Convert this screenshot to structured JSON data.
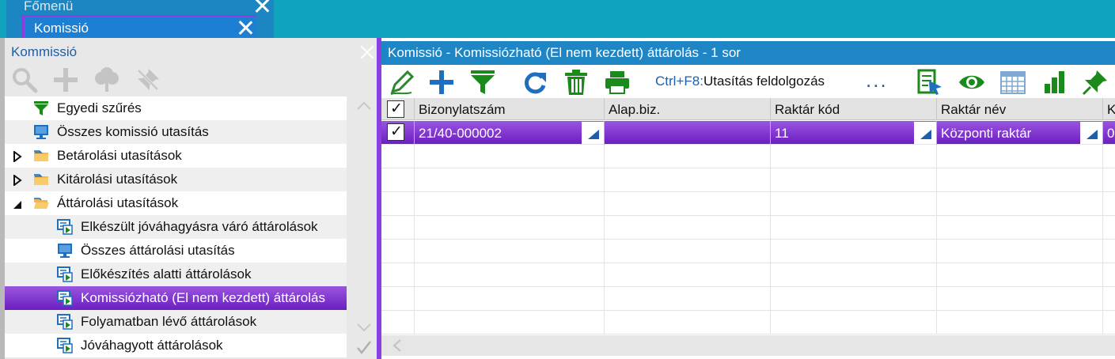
{
  "tabs": {
    "main_menu_label": "Főmenü",
    "active_tab_label": "Komissió"
  },
  "left_panel": {
    "title": "Kommissió",
    "tools": [
      "search-icon",
      "add-icon",
      "tree-icon",
      "unpin-icon"
    ],
    "tree": [
      {
        "label": "Egyedi szűrés",
        "icon": "filter-icon",
        "level": 0,
        "expander": ""
      },
      {
        "label": "Összes komissió utasítás",
        "icon": "monitor-icon",
        "level": 0,
        "expander": ""
      },
      {
        "label": "Betárolási utasítások",
        "icon": "folder-icon",
        "level": 0,
        "expander": "collapsed"
      },
      {
        "label": "Kitárolási utasítások",
        "icon": "folder-icon",
        "level": 0,
        "expander": "collapsed"
      },
      {
        "label": "Áttárolási utasítások",
        "icon": "folder-open-icon",
        "level": 0,
        "expander": "expanded"
      },
      {
        "label": "Elkészült jóváhagyásra váró áttárolások",
        "icon": "view-icon",
        "level": 1,
        "expander": ""
      },
      {
        "label": "Összes áttárolási utasítás",
        "icon": "monitor-icon",
        "level": 1,
        "expander": ""
      },
      {
        "label": "Előkészítés alatti áttárolások",
        "icon": "view-icon",
        "level": 1,
        "expander": ""
      },
      {
        "label": "Komissiózható (El nem kezdett) áttárolás",
        "icon": "view-icon",
        "level": 1,
        "expander": "",
        "selected": true
      },
      {
        "label": "Folyamatban lévő áttárolások",
        "icon": "view-icon",
        "level": 1,
        "expander": ""
      },
      {
        "label": "Jóváhagyott áttárolások",
        "icon": "view-icon",
        "level": 1,
        "expander": ""
      }
    ]
  },
  "right_panel": {
    "title": "Komissió - Komissiózható (El nem kezdett) áttárolás - 1 sor",
    "toolbar": {
      "shortcut_key": "Ctrl+F8:",
      "shortcut_label": "Utasítás feldolgozás",
      "more_label": "..."
    },
    "grid": {
      "columns": [
        "Bizonylatszám",
        "Alap.biz.",
        "Raktár kód",
        "Raktár név",
        "K"
      ],
      "rows": [
        {
          "checked": true,
          "cells": [
            "21/40-000002",
            "",
            "11",
            "Központi raktár",
            "0"
          ]
        }
      ],
      "empty_rows": 8
    }
  },
  "colors": {
    "accent_purple": "#8a3fe0",
    "title_blue": "#1f86c6",
    "icon_green": "#1a8a1a",
    "icon_blue": "#1f6fc0"
  }
}
